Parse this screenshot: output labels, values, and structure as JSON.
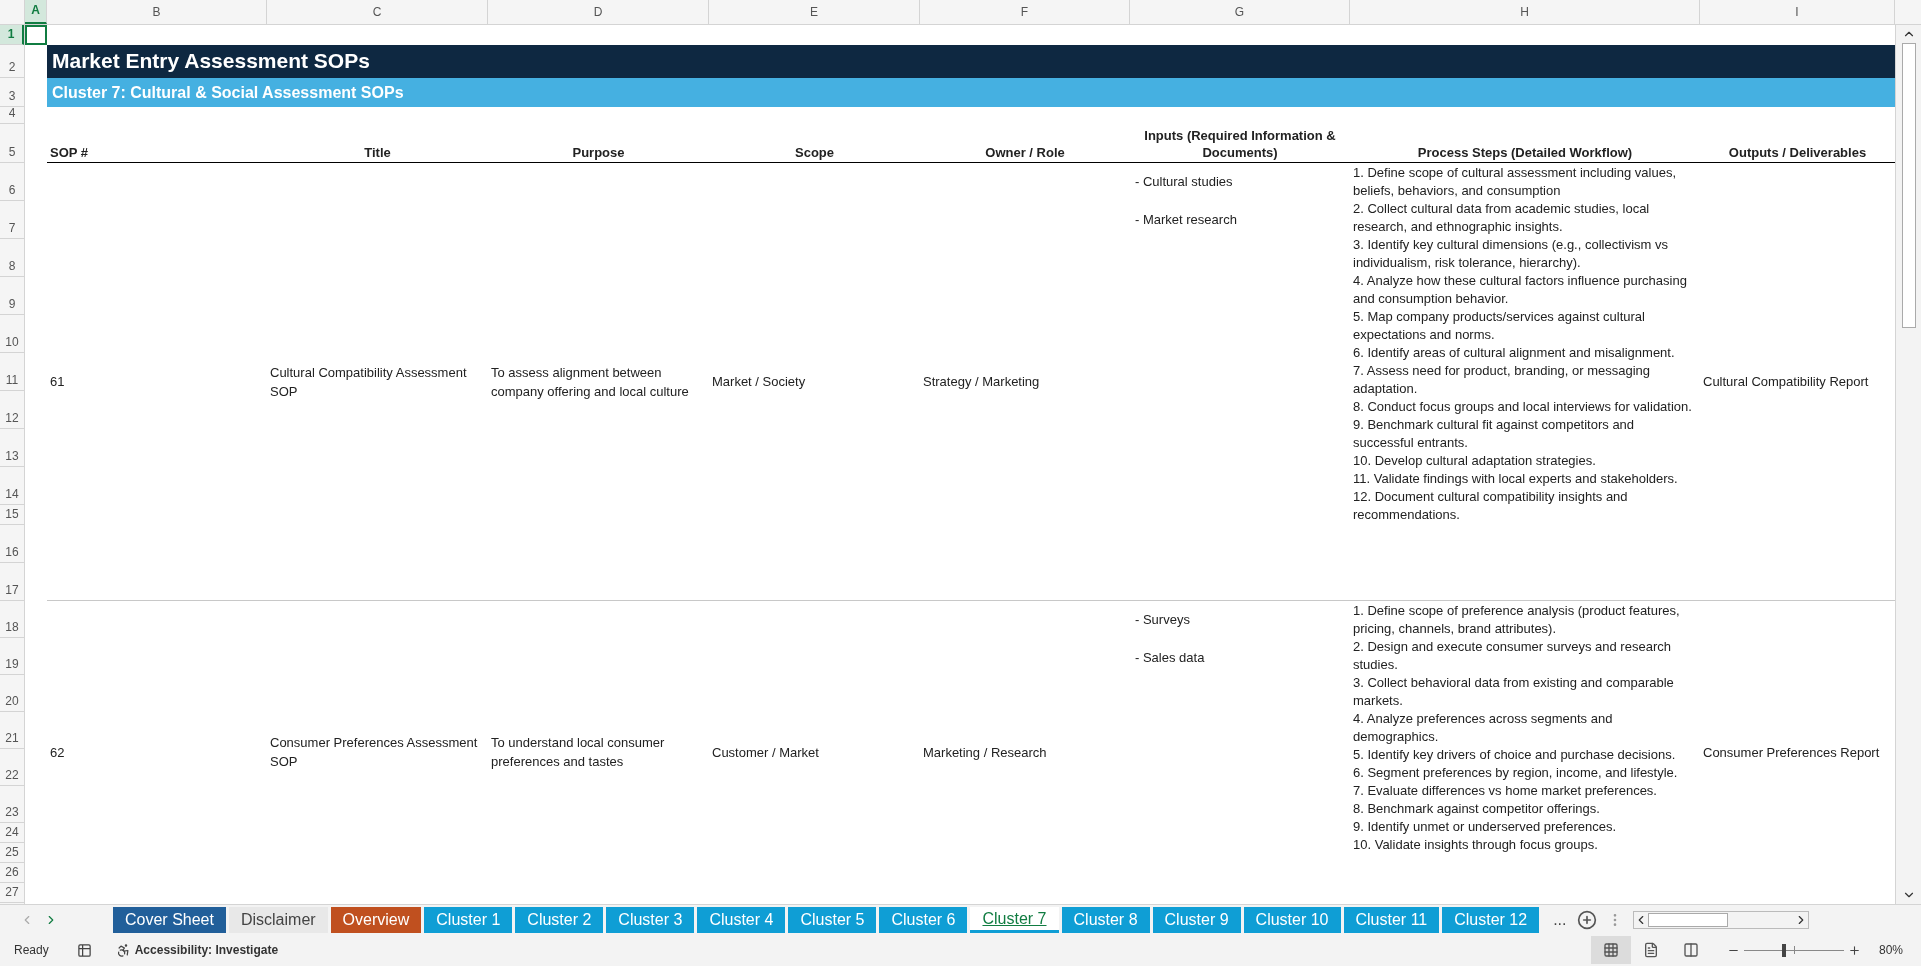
{
  "column_headers": [
    {
      "label": "A",
      "selected": true
    },
    {
      "label": "B",
      "selected": false
    },
    {
      "label": "C",
      "selected": false
    },
    {
      "label": "D",
      "selected": false
    },
    {
      "label": "E",
      "selected": false
    },
    {
      "label": "F",
      "selected": false
    },
    {
      "label": "G",
      "selected": false
    },
    {
      "label": "H",
      "selected": false
    },
    {
      "label": "I",
      "selected": false
    }
  ],
  "row_headers": [
    {
      "label": "1",
      "selected": true
    },
    {
      "label": "2",
      "selected": false
    },
    {
      "label": "3",
      "selected": false
    },
    {
      "label": "4",
      "selected": false
    },
    {
      "label": "5",
      "selected": false
    },
    {
      "label": "6",
      "selected": false
    },
    {
      "label": "7",
      "selected": false
    },
    {
      "label": "8",
      "selected": false
    },
    {
      "label": "9",
      "selected": false
    },
    {
      "label": "10",
      "selected": false
    },
    {
      "label": "11",
      "selected": false
    },
    {
      "label": "12",
      "selected": false
    },
    {
      "label": "13",
      "selected": false
    },
    {
      "label": "14",
      "selected": false
    },
    {
      "label": "15",
      "selected": false
    },
    {
      "label": "16",
      "selected": false
    },
    {
      "label": "17",
      "selected": false
    },
    {
      "label": "18",
      "selected": false
    },
    {
      "label": "19",
      "selected": false
    },
    {
      "label": "20",
      "selected": false
    },
    {
      "label": "21",
      "selected": false
    },
    {
      "label": "22",
      "selected": false
    },
    {
      "label": "23",
      "selected": false
    },
    {
      "label": "24",
      "selected": false
    },
    {
      "label": "25",
      "selected": false
    },
    {
      "label": "26",
      "selected": false
    },
    {
      "label": "27",
      "selected": false
    }
  ],
  "title": "Market Entry Assessment SOPs",
  "subtitle": "Cluster 7: Cultural & Social Assessment SOPs",
  "table": {
    "columns": [
      "SOP #",
      "Title",
      "Purpose",
      "Scope",
      "Owner / Role",
      "Inputs (Required Information & Documents)",
      "Process Steps (Detailed Workflow)",
      "Outputs / Deliverables"
    ],
    "rows": [
      {
        "sop": "61",
        "title": "Cultural Compatibility Assessment SOP",
        "purpose": "To assess alignment between company offering and local culture",
        "scope": "Market / Society",
        "owner": "Strategy / Marketing",
        "inputs": [
          "- Cultural studies",
          "- Market research"
        ],
        "steps": [
          "1. Define scope of cultural assessment including values, beliefs, behaviors, and consumption",
          "2. Collect cultural data from academic studies, local research, and ethnographic insights.",
          "3. Identify key cultural dimensions (e.g., collectivism vs individualism, risk tolerance, hierarchy).",
          "4. Analyze how these cultural factors influence purchasing and consumption behavior.",
          "5. Map company products/services against cultural expectations and norms.",
          "6. Identify areas of cultural alignment and misalignment.",
          "7. Assess need for product, branding, or messaging adaptation.",
          "8. Conduct focus groups and local interviews for validation.",
          "9. Benchmark cultural fit against competitors and successful entrants.",
          "10. Develop cultural adaptation strategies.",
          "11. Validate findings with local experts and stakeholders.",
          "12. Document cultural compatibility insights and recommendations."
        ],
        "outputs": "Cultural Compatibility Report"
      },
      {
        "sop": "62",
        "title": "Consumer Preferences Assessment SOP",
        "purpose": "To understand local consumer preferences and tastes",
        "scope": "Customer / Market",
        "owner": "Marketing / Research",
        "inputs": [
          "- Surveys",
          "- Sales data"
        ],
        "steps": [
          "1. Define scope of preference analysis (product features, pricing, channels, brand attributes).",
          "2. Design and execute consumer surveys and research studies.",
          "3. Collect behavioral data from existing and comparable markets.",
          "4. Analyze preferences across segments and demographics.",
          "5. Identify key drivers of choice and purchase decisions.",
          "6. Segment preferences by region, income, and lifestyle.",
          "7. Evaluate differences vs home market preferences.",
          "8. Benchmark against competitor offerings.",
          "9. Identify unmet or underserved preferences.",
          "10. Validate insights through focus groups."
        ],
        "outputs": "Consumer Preferences Report"
      }
    ]
  },
  "sheet_tabs": [
    {
      "label": "Cover Sheet",
      "selected": false,
      "color": "#215f9a"
    },
    {
      "label": "Disclaimer",
      "selected": false,
      "color": "#e8e8e8"
    },
    {
      "label": "Overview",
      "selected": false,
      "color": "#c0501f"
    },
    {
      "label": "Cluster 1",
      "selected": false,
      "color": "#0f9ed5"
    },
    {
      "label": "Cluster 2",
      "selected": false,
      "color": "#0f9ed5"
    },
    {
      "label": "Cluster 3",
      "selected": false,
      "color": "#0f9ed5"
    },
    {
      "label": "Cluster 4",
      "selected": false,
      "color": "#0f9ed5"
    },
    {
      "label": "Cluster 5",
      "selected": false,
      "color": "#0f9ed5"
    },
    {
      "label": "Cluster 6",
      "selected": false,
      "color": "#0f9ed5"
    },
    {
      "label": "Cluster 7",
      "selected": true,
      "color": "#0f9ed5"
    },
    {
      "label": "Cluster 8",
      "selected": false,
      "color": "#0f9ed5"
    },
    {
      "label": "Cluster 9",
      "selected": false,
      "color": "#0f9ed5"
    },
    {
      "label": "Cluster 10",
      "selected": false,
      "color": "#0f9ed5"
    },
    {
      "label": "Cluster 11",
      "selected": false,
      "color": "#0f9ed5"
    },
    {
      "label": "Cluster 12",
      "selected": false,
      "color": "#0f9ed5"
    }
  ],
  "more_tabs": "...",
  "status_bar": {
    "status": "Ready",
    "accessibility": "Accessibility: Investigate",
    "view_buttons": [
      {
        "kind": "normal",
        "selected": true
      },
      {
        "kind": "page_layout",
        "selected": false
      },
      {
        "kind": "page_break",
        "selected": false
      }
    ],
    "zoom": {
      "level": 0.4
    },
    "zoom_reading": "80%"
  }
}
